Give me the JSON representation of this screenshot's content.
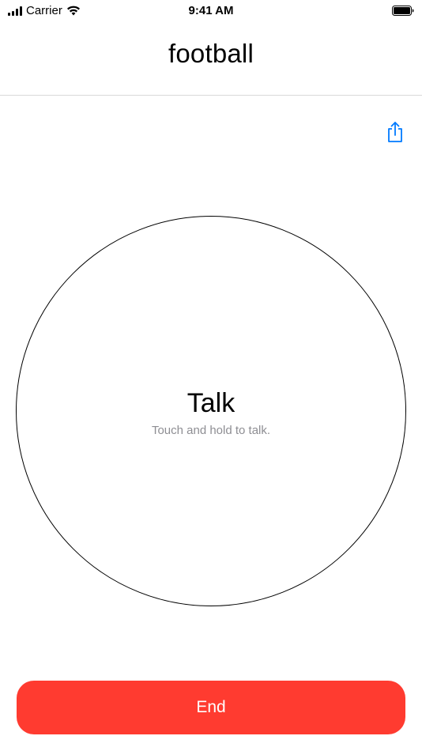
{
  "status_bar": {
    "carrier": "Carrier",
    "time": "9:41 AM",
    "signal_icon": "cellular-signal-icon",
    "wifi_icon": "wifi-icon",
    "battery_icon": "battery-icon"
  },
  "nav": {
    "title": "football",
    "share_icon": "share-icon"
  },
  "talk": {
    "label": "Talk",
    "hint": "Touch and hold to talk."
  },
  "footer": {
    "end_label": "End"
  },
  "colors": {
    "accent": "#007aff",
    "end_button": "#ff3b30",
    "hint_text": "#8e8e93",
    "divider": "#d9d9d9"
  }
}
